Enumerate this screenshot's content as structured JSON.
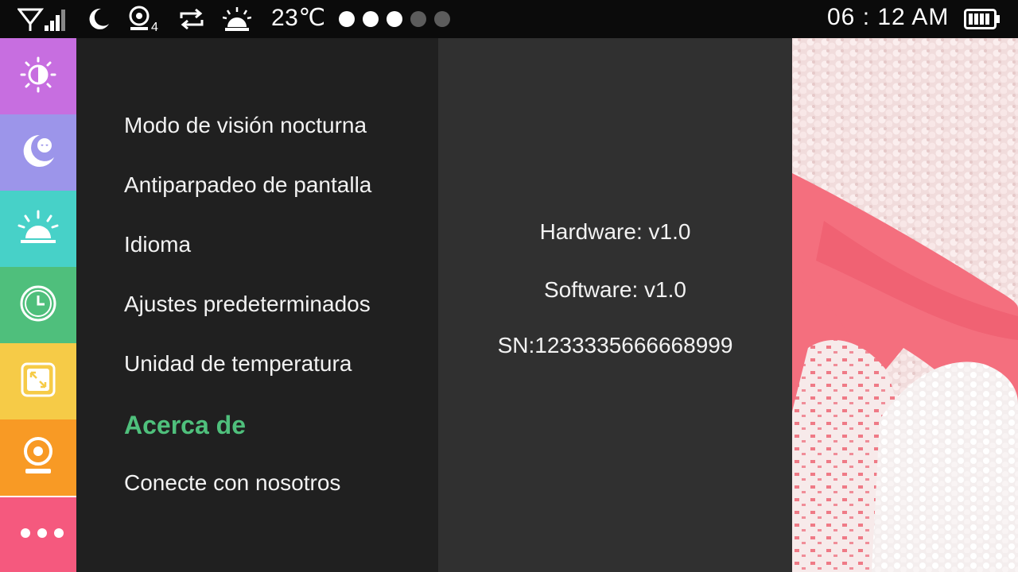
{
  "status_bar": {
    "temperature": "23℃",
    "signal_dots_on": 3,
    "signal_dots_total": 5,
    "camera_count": "4",
    "time": "06 : 12  AM",
    "icons": [
      "wifi-signal-icon",
      "moon-icon",
      "camera-icon",
      "repeat-icon",
      "alarm-icon",
      "battery-icon"
    ]
  },
  "rail": {
    "items": [
      {
        "name": "brightness",
        "icon": "brightness-icon",
        "color": "#c76ee0"
      },
      {
        "name": "lullaby",
        "icon": "baby-moon-icon",
        "color": "#9c95ea"
      },
      {
        "name": "alarm",
        "icon": "alarm-icon",
        "color": "#47d1c8"
      },
      {
        "name": "timer",
        "icon": "clock-icon",
        "color": "#4fbf7c"
      },
      {
        "name": "zoom",
        "icon": "zoom-icon",
        "color": "#f6cb47"
      },
      {
        "name": "camera",
        "icon": "camera-icon",
        "color": "#f89a25"
      },
      {
        "name": "more",
        "icon": "more-dots-icon",
        "color": "#f5597e"
      }
    ]
  },
  "menu": {
    "items": [
      "Modo de visión nocturna",
      "Antiparpadeo de pantalla",
      "Idioma",
      "Ajustes predeterminados",
      "Unidad de temperatura",
      "Acerca de",
      "Conecte con nosotros"
    ],
    "selected_index": 5,
    "selected_color": "#4fc07c"
  },
  "about": {
    "hardware": "Hardware: v1.0",
    "software": "Software: v1.0",
    "serial": "SN:1233335666668999"
  }
}
